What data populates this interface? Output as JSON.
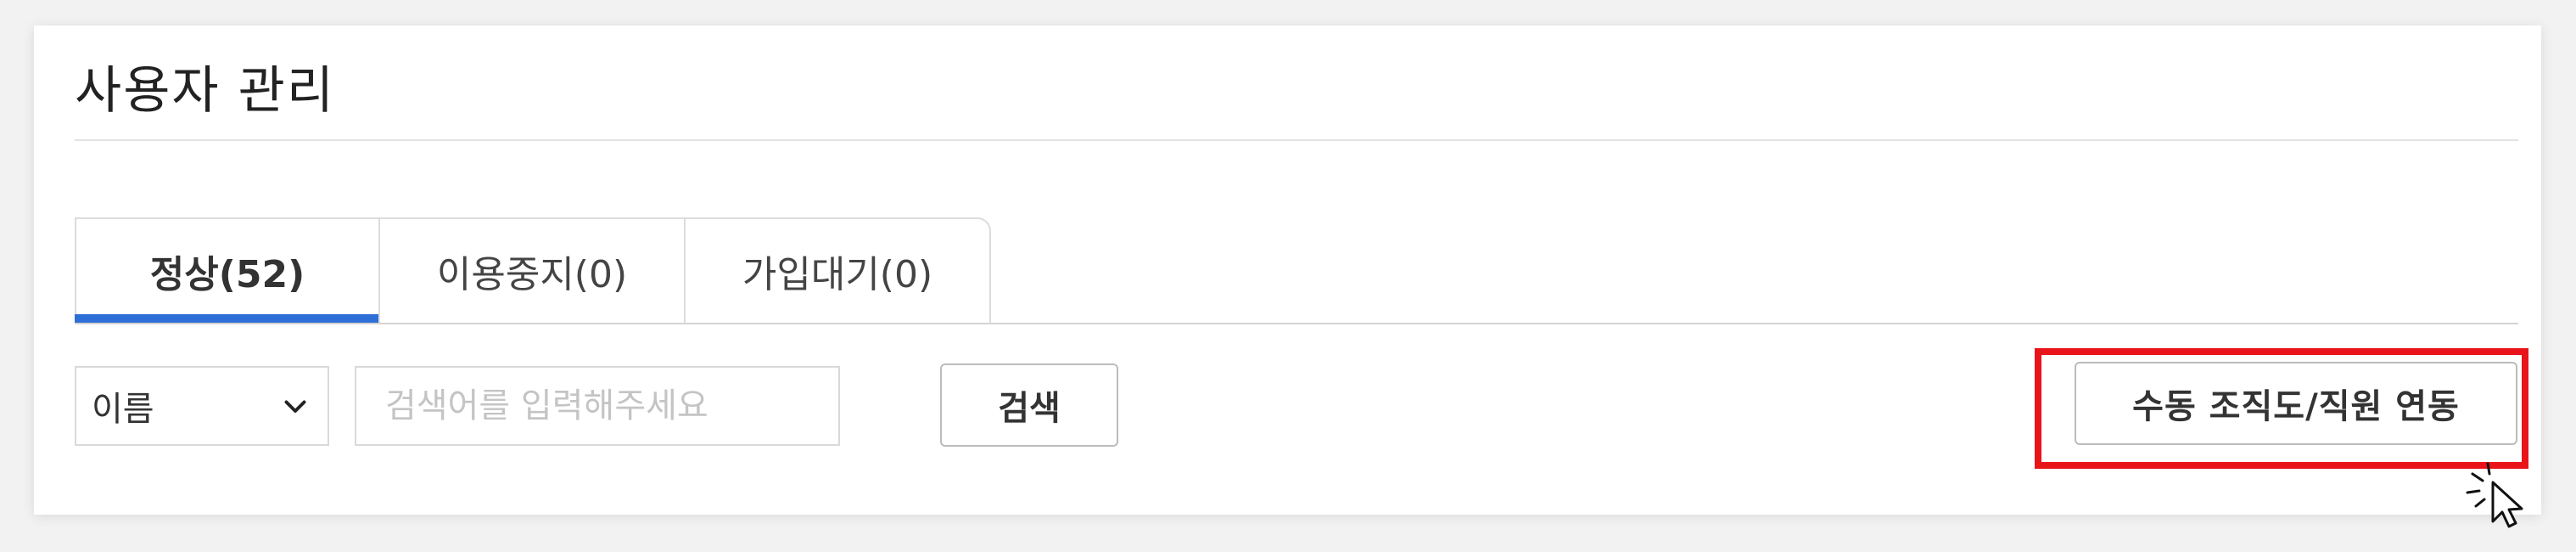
{
  "page": {
    "title": "사용자 관리"
  },
  "tabs": [
    {
      "label": "정상(52)",
      "active": true
    },
    {
      "label": "이용중지(0)",
      "active": false
    },
    {
      "label": "가입대기(0)",
      "active": false
    }
  ],
  "search": {
    "field_select_value": "이름",
    "placeholder": "검색어를 입력해주세요",
    "value": "",
    "button_label": "검색"
  },
  "actions": {
    "sync_button_label": "수동 조직도/직원 연동"
  },
  "icons": {
    "select_arrow": "chevron-down-icon",
    "cursor": "click-cursor-icon"
  },
  "colors": {
    "active_tab_bar": "#2d6fd6",
    "highlight_box": "#e8141a"
  }
}
